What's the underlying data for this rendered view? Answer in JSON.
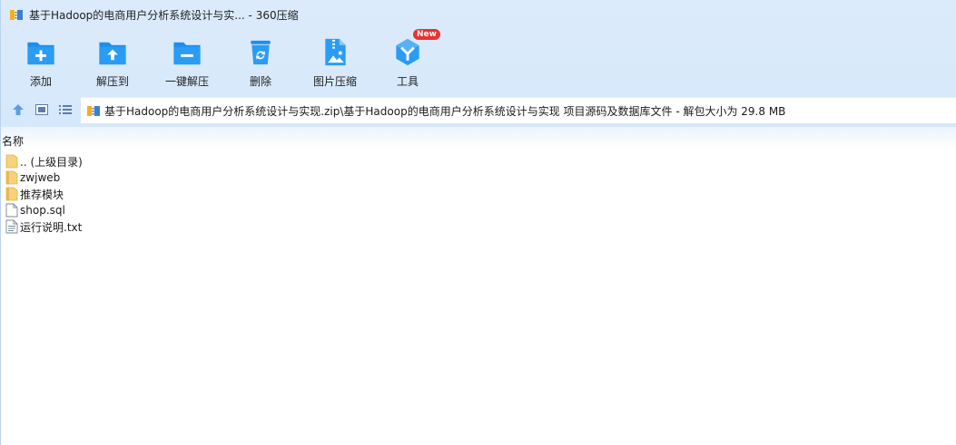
{
  "window": {
    "title": "基于Hadoop的电商用户分析系统设计与实... - 360压缩"
  },
  "toolbar": {
    "buttons": [
      {
        "label": "添加",
        "icon": "add-folder-icon"
      },
      {
        "label": "解压到",
        "icon": "extract-to-icon"
      },
      {
        "label": "一键解压",
        "icon": "one-click-extract-icon"
      },
      {
        "label": "删除",
        "icon": "trash-icon"
      },
      {
        "label": "图片压缩",
        "icon": "image-compress-icon"
      },
      {
        "label": "工具",
        "icon": "tools-icon",
        "badge": "New"
      }
    ]
  },
  "address": {
    "path": "基于Hadoop的电商用户分析系统设计与实现.zip\\基于Hadoop的电商用户分析系统设计与实现 项目源码及数据库文件 - 解包大小为 29.8 MB"
  },
  "list": {
    "column_name": "名称",
    "items": [
      {
        "name": ".. (上级目录)",
        "type": "folder-up"
      },
      {
        "name": "zwjweb",
        "type": "folder"
      },
      {
        "name": "推荐模块",
        "type": "folder"
      },
      {
        "name": "shop.sql",
        "type": "file"
      },
      {
        "name": "运行说明.txt",
        "type": "text-file"
      }
    ]
  },
  "colors": {
    "accent": "#1a8ff0",
    "top_bg": "#d9eafb",
    "badge": "#e8322e"
  }
}
